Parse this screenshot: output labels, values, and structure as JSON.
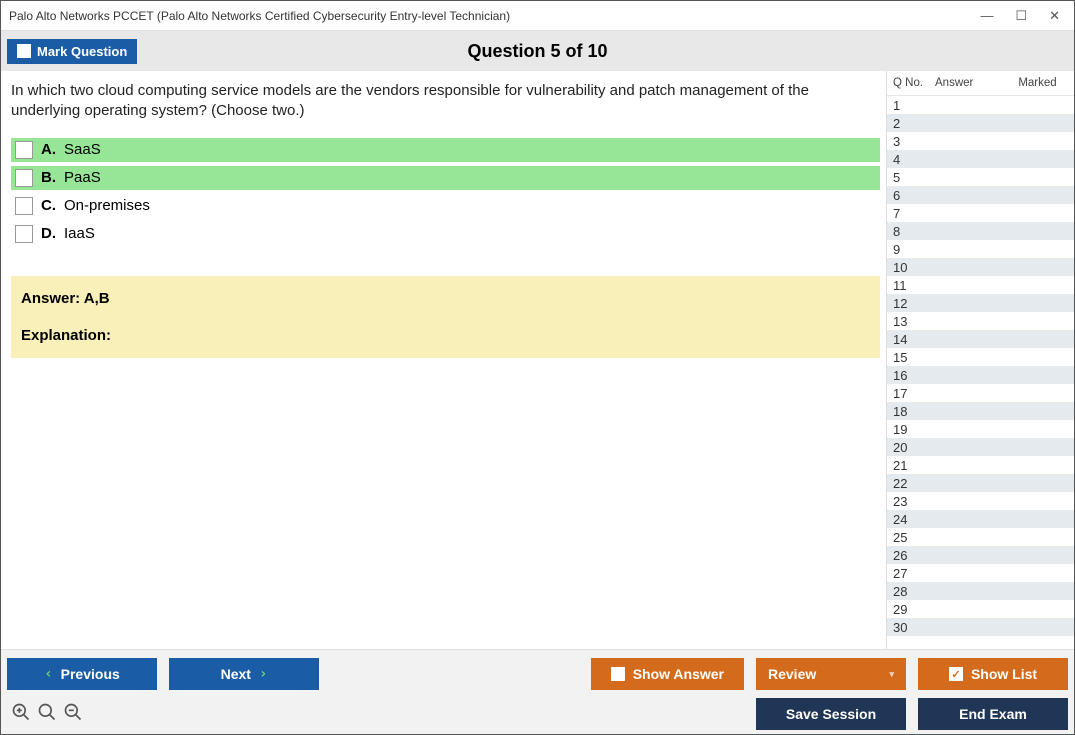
{
  "window": {
    "title": "Palo Alto Networks PCCET (Palo Alto Networks Certified Cybersecurity Entry-level Technician)"
  },
  "header": {
    "mark_label": "Mark Question",
    "question_title": "Question 5 of 10"
  },
  "question": {
    "text": "In which two cloud computing service models are the vendors responsible for vulnerability and patch management of the underlying operating system? (Choose two.)",
    "options": [
      {
        "letter": "A.",
        "text": "SaaS",
        "correct": true
      },
      {
        "letter": "B.",
        "text": "PaaS",
        "correct": true
      },
      {
        "letter": "C.",
        "text": "On-premises",
        "correct": false
      },
      {
        "letter": "D.",
        "text": "IaaS",
        "correct": false
      }
    ]
  },
  "answer_box": {
    "answer_label": "Answer: A,B",
    "explanation_label": "Explanation:"
  },
  "side_panel": {
    "headers": {
      "qno": "Q No.",
      "answer": "Answer",
      "marked": "Marked"
    },
    "row_count": 30
  },
  "footer": {
    "previous": "Previous",
    "next": "Next",
    "show_answer": "Show Answer",
    "review": "Review",
    "show_list": "Show List",
    "save_session": "Save Session",
    "end_exam": "End Exam"
  }
}
